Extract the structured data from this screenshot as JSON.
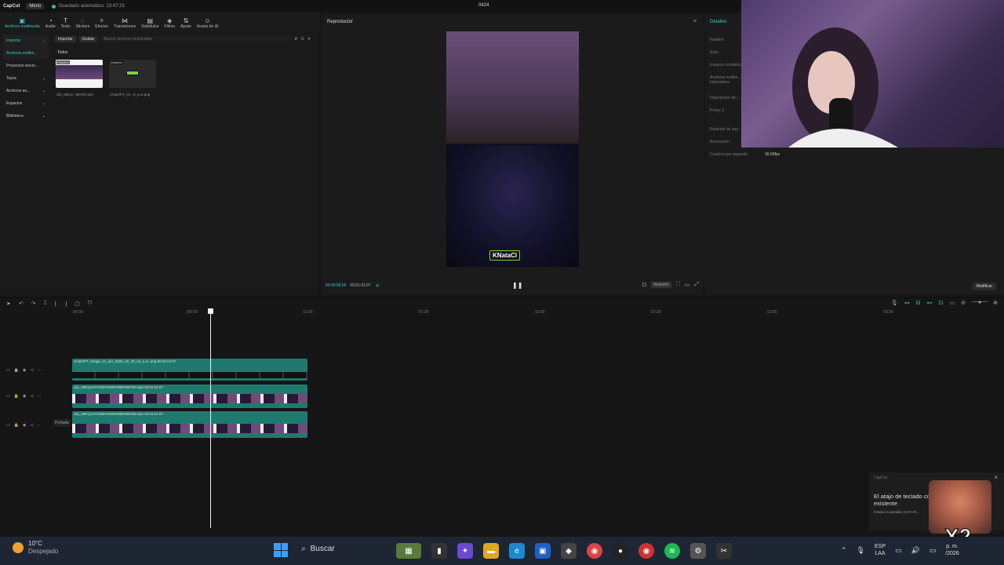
{
  "topbar": {
    "logo": "CapCut",
    "menu": "Menú",
    "autosave": "Guardado automático: 23:47:23",
    "project": "0424"
  },
  "toolbar": {
    "items": [
      {
        "label": "Archivos multimedia",
        "icon": "media-icon"
      },
      {
        "label": "Audio",
        "icon": "audio-icon"
      },
      {
        "label": "Texto",
        "icon": "text-icon"
      },
      {
        "label": "Stickers",
        "icon": "sticker-icon"
      },
      {
        "label": "Efectos",
        "icon": "effects-icon"
      },
      {
        "label": "Transiciones",
        "icon": "transitions-icon"
      },
      {
        "label": "Subtítulos",
        "icon": "subtitles-icon"
      },
      {
        "label": "Filtros",
        "icon": "filters-icon"
      },
      {
        "label": "Ajuste",
        "icon": "adjust-icon"
      },
      {
        "label": "Avatar de IA",
        "icon": "avatar-icon"
      }
    ]
  },
  "media": {
    "sidebar": [
      "Importar",
      "Archivos multim...",
      "Proyectos secun...",
      "Tayos",
      "Archivos au...",
      "Espacios",
      "Biblioteca"
    ],
    "import_btn": "Importar",
    "record_btn": "Grabar",
    "search_placeholder": "Buscar archivos multimedia",
    "all_label": "Todos",
    "items": [
      {
        "tag": "Añadido",
        "name": "clip_09KQ...8870tt.mp4"
      },
      {
        "tag": "Añadido",
        "name": "ChatGPT_Im...8_a.m.png"
      }
    ]
  },
  "player": {
    "title": "Reproductor",
    "badge": "KNataCl",
    "time_current": "00:00:58:05",
    "time_total": "00:01:01:07",
    "ratio": "Relación"
  },
  "details": {
    "title": "Detalles",
    "rows": [
      {
        "label": "Nombre:",
        "value": ""
      },
      {
        "label": "Ruta:",
        "value": ""
      },
      {
        "label": "Espacio cromático:",
        "value": ""
      },
      {
        "label": "Archivos multim... importados:",
        "value": ""
      },
      {
        "label": "Disposición del...",
        "value": ""
      },
      {
        "label": "Proxy: 0",
        "value": ""
      },
      {
        "label": "Relación de asp...",
        "value": ""
      },
      {
        "label": "Resolución:",
        "value": ""
      },
      {
        "label": "Cuadros por segundo:",
        "value": "30.00fps"
      }
    ],
    "modify": "Modificar"
  },
  "ruler": [
    "00:00",
    "|00:30",
    "01:00",
    "01:30",
    "02:00",
    "02:30",
    "03:00",
    "03:30"
  ],
  "tracks": [
    {
      "label": "ChatGPT_Image_21_abr_2026_02_39_43_a.m..png   00:01:01:07",
      "type": "img"
    },
    {
      "label": "clip_09KQ1AFXGBHV9WKR8ER8870tt.mp4   00:01:01:07",
      "type": "video"
    },
    {
      "label": "clip_09KQ1AFXGBHV9WKR8ER8870tt.mp4   00:01:01:07",
      "type": "video"
    }
  ],
  "cover": "Portada",
  "toast": {
    "source": "CapCut",
    "title": "El atajo de teclado con otro existente",
    "body": "Grabar la pantalla: [Ctrl+Alt...",
    "close": "×"
  },
  "meme": "X2",
  "taskbar": {
    "temp": "10°C",
    "weather": "Despejado",
    "search": "Buscar",
    "lang1": "ESP",
    "lang2": "LAA",
    "clock": "p. m.",
    "date": "/2026"
  }
}
